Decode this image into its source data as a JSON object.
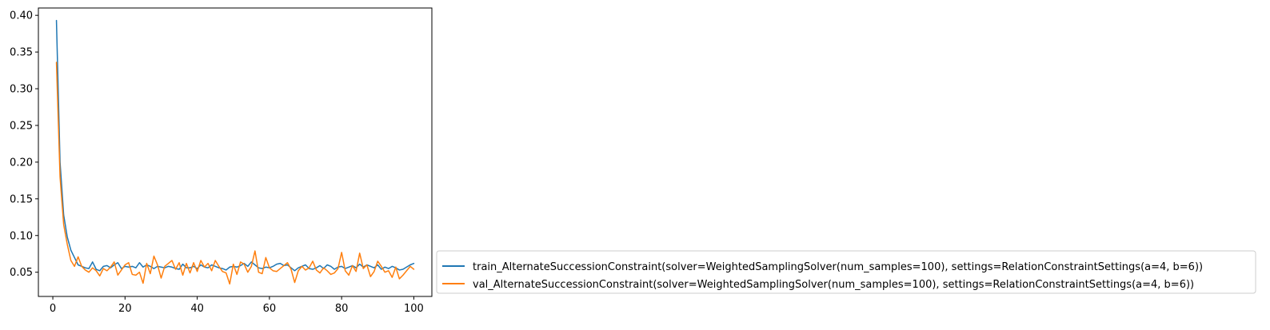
{
  "chart_data": {
    "type": "line",
    "title": "",
    "xlabel": "",
    "ylabel": "",
    "xlim": [
      -4,
      105
    ],
    "ylim": [
      0.017,
      0.41
    ],
    "xticks": [
      0,
      20,
      40,
      60,
      80,
      100
    ],
    "xtick_labels": [
      "0",
      "20",
      "40",
      "60",
      "80",
      "100"
    ],
    "yticks": [
      0.05,
      0.1,
      0.15,
      0.2,
      0.25,
      0.3,
      0.35,
      0.4
    ],
    "ytick_labels": [
      "0.05",
      "0.10",
      "0.15",
      "0.20",
      "0.25",
      "0.30",
      "0.35",
      "0.40"
    ],
    "grid": false,
    "legend_position": "outside-right-bottom",
    "x": [
      1,
      2,
      3,
      4,
      5,
      6,
      7,
      8,
      9,
      10,
      11,
      12,
      13,
      14,
      15,
      16,
      17,
      18,
      19,
      20,
      21,
      22,
      23,
      24,
      25,
      26,
      27,
      28,
      29,
      30,
      31,
      32,
      33,
      34,
      35,
      36,
      37,
      38,
      39,
      40,
      41,
      42,
      43,
      44,
      45,
      46,
      47,
      48,
      49,
      50,
      51,
      52,
      53,
      54,
      55,
      56,
      57,
      58,
      59,
      60,
      61,
      62,
      63,
      64,
      65,
      66,
      67,
      68,
      69,
      70,
      71,
      72,
      73,
      74,
      75,
      76,
      77,
      78,
      79,
      80,
      81,
      82,
      83,
      84,
      85,
      86,
      87,
      88,
      89,
      90,
      91,
      92,
      93,
      94,
      95,
      96,
      97,
      98,
      99,
      100
    ],
    "series": [
      {
        "name": "train_AlternateSuccessionConstraint(solver=WeightedSamplingSolver(num_samples=100), settings=RelationConstraintSettings(a=4, b=6))",
        "color": "#1f77b4",
        "values": [
          0.393,
          0.2,
          0.128,
          0.098,
          0.08,
          0.07,
          0.06,
          0.058,
          0.056,
          0.055,
          0.064,
          0.054,
          0.052,
          0.058,
          0.059,
          0.056,
          0.06,
          0.063,
          0.055,
          0.058,
          0.057,
          0.058,
          0.056,
          0.063,
          0.057,
          0.06,
          0.058,
          0.055,
          0.058,
          0.057,
          0.056,
          0.058,
          0.057,
          0.055,
          0.054,
          0.061,
          0.056,
          0.056,
          0.058,
          0.055,
          0.06,
          0.057,
          0.056,
          0.06,
          0.058,
          0.056,
          0.055,
          0.053,
          0.057,
          0.058,
          0.057,
          0.059,
          0.062,
          0.058,
          0.064,
          0.06,
          0.056,
          0.055,
          0.057,
          0.056,
          0.058,
          0.061,
          0.062,
          0.059,
          0.06,
          0.056,
          0.052,
          0.056,
          0.058,
          0.06,
          0.055,
          0.054,
          0.056,
          0.059,
          0.055,
          0.06,
          0.058,
          0.054,
          0.057,
          0.058,
          0.055,
          0.057,
          0.059,
          0.056,
          0.061,
          0.057,
          0.06,
          0.058,
          0.056,
          0.06,
          0.054,
          0.057,
          0.055,
          0.058,
          0.056,
          0.053,
          0.054,
          0.057,
          0.06,
          0.062
        ]
      },
      {
        "name": "val_AlternateSuccessionConstraint(solver=WeightedSamplingSolver(num_samples=100), settings=RelationConstraintSettings(a=4, b=6))",
        "color": "#ff7f0e",
        "values": [
          0.336,
          0.18,
          0.115,
          0.088,
          0.066,
          0.058,
          0.071,
          0.058,
          0.053,
          0.05,
          0.056,
          0.052,
          0.045,
          0.055,
          0.052,
          0.057,
          0.064,
          0.046,
          0.053,
          0.06,
          0.063,
          0.047,
          0.046,
          0.05,
          0.035,
          0.062,
          0.048,
          0.072,
          0.06,
          0.042,
          0.058,
          0.062,
          0.066,
          0.054,
          0.063,
          0.046,
          0.062,
          0.049,
          0.063,
          0.051,
          0.066,
          0.057,
          0.062,
          0.052,
          0.066,
          0.058,
          0.051,
          0.049,
          0.034,
          0.061,
          0.047,
          0.064,
          0.061,
          0.05,
          0.058,
          0.079,
          0.05,
          0.048,
          0.07,
          0.056,
          0.052,
          0.051,
          0.055,
          0.059,
          0.063,
          0.054,
          0.036,
          0.052,
          0.058,
          0.053,
          0.056,
          0.065,
          0.053,
          0.049,
          0.056,
          0.052,
          0.047,
          0.049,
          0.055,
          0.077,
          0.052,
          0.046,
          0.059,
          0.051,
          0.076,
          0.055,
          0.06,
          0.044,
          0.051,
          0.065,
          0.058,
          0.05,
          0.052,
          0.043,
          0.057,
          0.041,
          0.046,
          0.052,
          0.058,
          0.054
        ]
      }
    ]
  }
}
